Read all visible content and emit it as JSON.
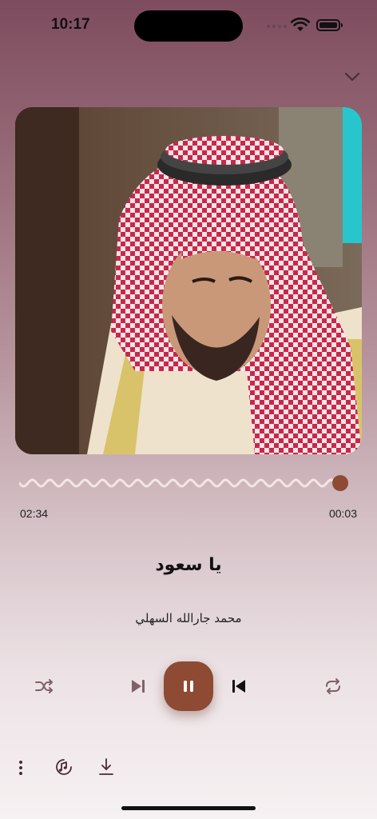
{
  "status_bar": {
    "time": "10:17"
  },
  "player": {
    "title": "يا سعود",
    "artist": "محمد جارالله السهلي",
    "elapsed": "02:34",
    "total": "00:03",
    "progress_fraction": 0.98
  },
  "colors": {
    "accent": "#8f4a33",
    "wave": "#f3e6e3",
    "thumb": "#8f4a33"
  },
  "icons": {
    "collapse": "chevron-down-icon",
    "shuffle": "shuffle-icon",
    "next": "skip-next-icon",
    "pause": "pause-icon",
    "previous": "skip-previous-icon",
    "repeat": "repeat-icon",
    "more": "more-vertical-icon",
    "lyrics": "lyrics-icon",
    "download": "download-icon"
  }
}
